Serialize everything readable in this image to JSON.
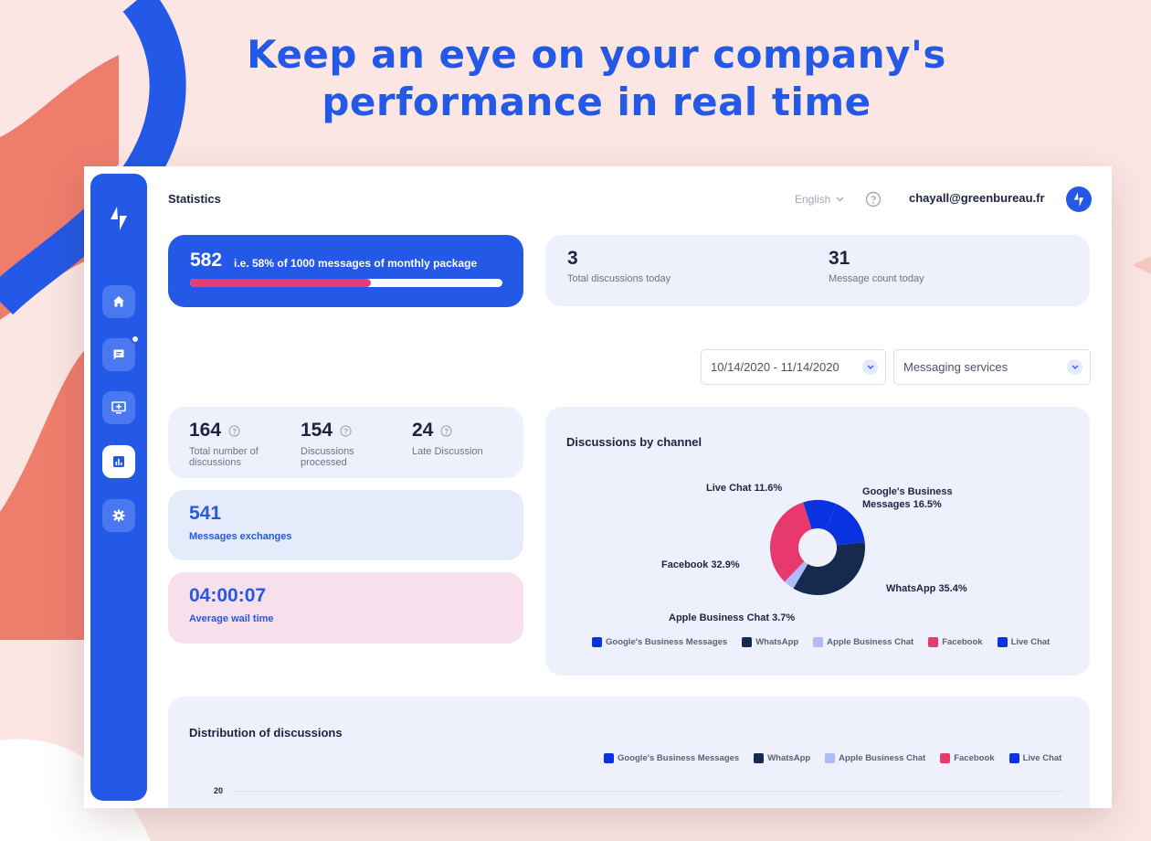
{
  "headline": {
    "line1": "Keep an eye on your company's",
    "line2": "performance in real time"
  },
  "header": {
    "title": "Statistics",
    "language": "English",
    "user_email": "chayall@greenbureau.fr"
  },
  "sidebar": {
    "items": [
      {
        "icon": "home-icon",
        "active": false
      },
      {
        "icon": "message-icon",
        "active": false,
        "badge": true
      },
      {
        "icon": "monitor-add-icon",
        "active": false
      },
      {
        "icon": "bar-chart-icon",
        "active": true
      },
      {
        "icon": "gear-icon",
        "active": false
      }
    ]
  },
  "usage": {
    "count": "582",
    "text": "i.e. 58% of 1000 messages of monthly package",
    "progress": 0.58
  },
  "today": {
    "discussions_value": "3",
    "discussions_label": "Total discussions today",
    "messages_value": "31",
    "messages_label": "Message count today"
  },
  "filters": {
    "date_range": "10/14/2020 - 11/14/2020",
    "service": "Messaging services"
  },
  "stats": {
    "total": {
      "value": "164",
      "label": "Total number of discussions"
    },
    "processed": {
      "value": "154",
      "label": "Discussions processed"
    },
    "late": {
      "value": "24",
      "label": "Late Discussion"
    }
  },
  "exchanges": {
    "value": "541",
    "label": "Messages exchanges"
  },
  "wait": {
    "value": "04:00:07",
    "label": "Average wail time"
  },
  "colors": {
    "google": "#0b32e0",
    "whatsapp": "#162a4f",
    "apple": "#aebbf7",
    "facebook": "#e8396f",
    "livechat": "#0b32e0",
    "accent": "#2458e6"
  },
  "chart_data": [
    {
      "type": "pie",
      "title": "Discussions by channel",
      "slices": [
        {
          "name": "Google's Business Messages",
          "value": 16.5,
          "label": "Google's Business Messages 16.5%"
        },
        {
          "name": "WhatsApp",
          "value": 35.4,
          "label": "WhatsApp 35.4%"
        },
        {
          "name": "Apple Business Chat",
          "value": 3.7,
          "label": "Apple Business Chat 3.7%"
        },
        {
          "name": "Facebook",
          "value": 32.9,
          "label": "Facebook 32.9%"
        },
        {
          "name": "Live Chat",
          "value": 11.6,
          "label": "Live Chat 11.6%"
        }
      ],
      "legend": [
        "Google's Business Messages",
        "WhatsApp",
        "Apple Business Chat",
        "Facebook",
        "Live Chat"
      ],
      "legend_position": "bottom"
    },
    {
      "type": "bar",
      "title": "Distribution of discussions",
      "legend": [
        "Google's Business Messages",
        "WhatsApp",
        "Apple Business Chat",
        "Facebook",
        "Live Chat"
      ],
      "legend_position": "top-right",
      "y_ticks": [
        "20"
      ]
    }
  ]
}
